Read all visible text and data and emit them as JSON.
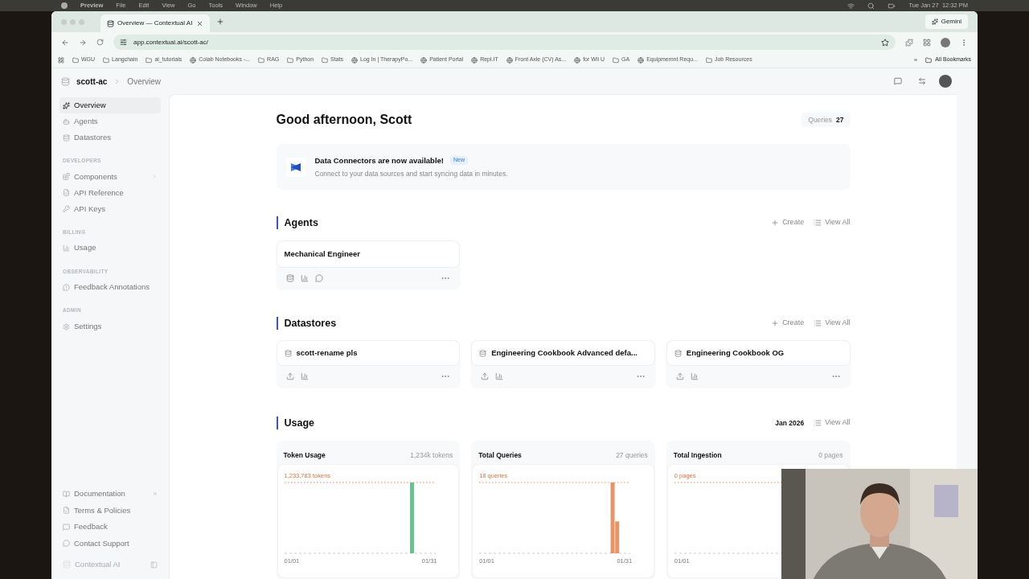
{
  "menu_bar": {
    "app": "Preview",
    "items": [
      "File",
      "Edit",
      "View",
      "Go",
      "Tools",
      "Window",
      "Help"
    ],
    "clock": "Tue Jan 27  12:32 PM"
  },
  "browser": {
    "tab_title": "Overview — Contextual AI",
    "url": "app.contextual.ai/scott-ac/",
    "gemini": "Gemini",
    "more": "»",
    "all_bookmarks": "All Bookmarks",
    "bookmarks": [
      {
        "label": "WGU",
        "kind": "folder"
      },
      {
        "label": "Langchain",
        "kind": "folder"
      },
      {
        "label": "ai_tutorials",
        "kind": "folder"
      },
      {
        "label": "Colab Notebooks -...",
        "kind": "site"
      },
      {
        "label": "RAG",
        "kind": "folder"
      },
      {
        "label": "Python",
        "kind": "folder"
      },
      {
        "label": "Stats",
        "kind": "folder"
      },
      {
        "label": "Log In | TherapyPo...",
        "kind": "site"
      },
      {
        "label": "Patient Portal",
        "kind": "site"
      },
      {
        "label": "Repl.IT",
        "kind": "site"
      },
      {
        "label": "Front Axle (CV) As...",
        "kind": "site"
      },
      {
        "label": "for Wii U",
        "kind": "site"
      },
      {
        "label": "GA",
        "kind": "folder"
      },
      {
        "label": "Equipmemnt Requ...",
        "kind": "site"
      },
      {
        "label": "Job Resources",
        "kind": "folder"
      }
    ]
  },
  "breadcrumb": [
    "scott-ac",
    "Overview"
  ],
  "sidebar": {
    "groups": [
      {
        "items": [
          {
            "label": "Overview",
            "selected": true,
            "kind": "link"
          },
          {
            "label": "Agents",
            "selected": false,
            "kind": "link"
          },
          {
            "label": "Datastores",
            "selected": false,
            "kind": "link"
          }
        ]
      },
      {
        "heading": "DEVELOPERS",
        "items": [
          {
            "label": "Components",
            "selected": false,
            "kind": "expandable"
          },
          {
            "label": "API Reference",
            "selected": false,
            "kind": "link"
          },
          {
            "label": "API Keys",
            "selected": false,
            "kind": "link"
          }
        ]
      },
      {
        "heading": "BILLING",
        "items": [
          {
            "label": "Usage",
            "selected": false,
            "kind": "link"
          }
        ]
      },
      {
        "heading": "OBSERVABILITY",
        "items": [
          {
            "label": "Feedback Annotations",
            "selected": false,
            "kind": "link"
          }
        ]
      },
      {
        "heading": "ADMIN",
        "items": [
          {
            "label": "Settings",
            "selected": false,
            "kind": "link"
          }
        ]
      }
    ],
    "footer_items": [
      {
        "label": "Documentation",
        "kind": "external"
      },
      {
        "label": "Terms & Policies",
        "kind": "link"
      },
      {
        "label": "Feedback",
        "kind": "link"
      },
      {
        "label": "Contact Support",
        "kind": "link"
      }
    ],
    "brand": "Contextual AI"
  },
  "greeting": "Good afternoon, Scott",
  "queries": {
    "label": "Queries",
    "value": "27"
  },
  "banner": {
    "title": "Data Connectors are now available!",
    "badge": "New",
    "text": "Connect to your data sources and start syncing data in minutes."
  },
  "agents": {
    "title": "Agents",
    "create": "Create",
    "view_all": "View All",
    "items": [
      {
        "name": "Mechanical Engineer"
      }
    ]
  },
  "datastores": {
    "title": "Datastores",
    "create": "Create",
    "view_all": "View All",
    "items": [
      {
        "name": "scott-rename pls"
      },
      {
        "name": "Engineering Cookbook Advanced defa..."
      },
      {
        "name": "Engineering Cookbook OG"
      }
    ]
  },
  "usage": {
    "title": "Usage",
    "period": "Jan 2026",
    "view_all": "View All",
    "cards": [
      {
        "title": "Token Usage",
        "total": "1,234k tokens",
        "peak": "1,233,783 tokens",
        "x_start": "01/01",
        "x_end": "01/31",
        "color": "#6cc08f"
      },
      {
        "title": "Total Queries",
        "total": "27 queries",
        "peak": "18 queries",
        "x_start": "01/01",
        "x_end": "01/31",
        "color": "#e99466"
      },
      {
        "title": "Total Ingestion",
        "total": "0 pages",
        "peak": "0 pages",
        "x_start": "01/01"
      }
    ]
  }
}
